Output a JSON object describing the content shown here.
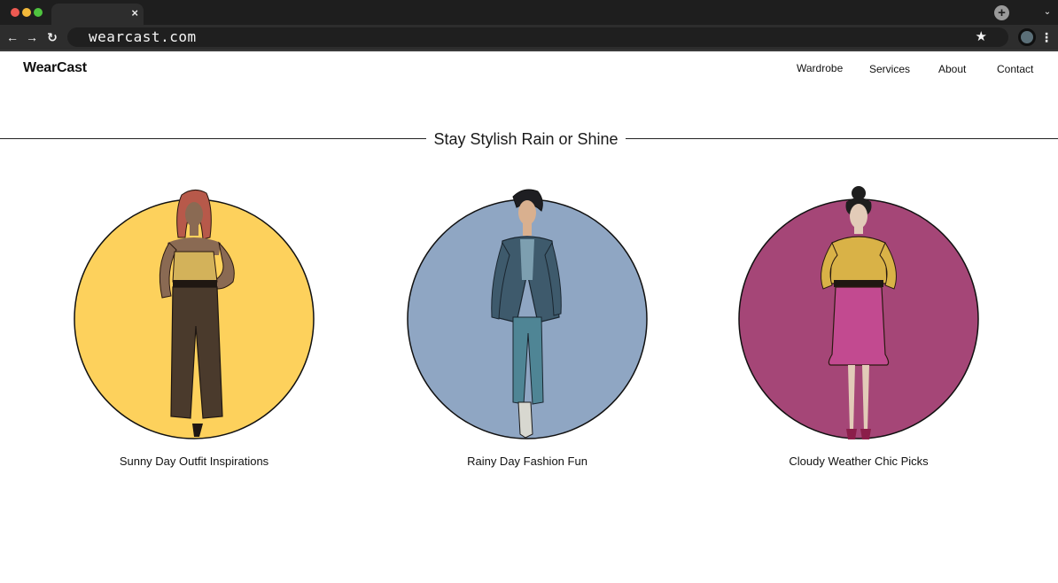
{
  "browser": {
    "url": "wearcast.com",
    "tab_close": "×",
    "new_tab": "+",
    "tab_menu": "⌄",
    "back": "←",
    "forward": "→",
    "reload": "↻",
    "bookmark": "★",
    "menu": "⋮"
  },
  "site": {
    "logo": "WearCast",
    "nav": [
      "Wardrobe",
      "Services",
      "About",
      "Contact"
    ]
  },
  "hero": {
    "title": "Stay Stylish Rain or Shine"
  },
  "cards": [
    {
      "caption": "Sunny Day Outfit Inspirations",
      "circle_color": "#fdd15c",
      "icon": "sunny-outfit-illustration"
    },
    {
      "caption": "Rainy Day Fashion Fun",
      "circle_color": "#8fa6c3",
      "icon": "rainy-outfit-illustration"
    },
    {
      "caption": "Cloudy Weather Chic Picks",
      "circle_color": "#a54677",
      "icon": "cloudy-outfit-illustration"
    }
  ]
}
